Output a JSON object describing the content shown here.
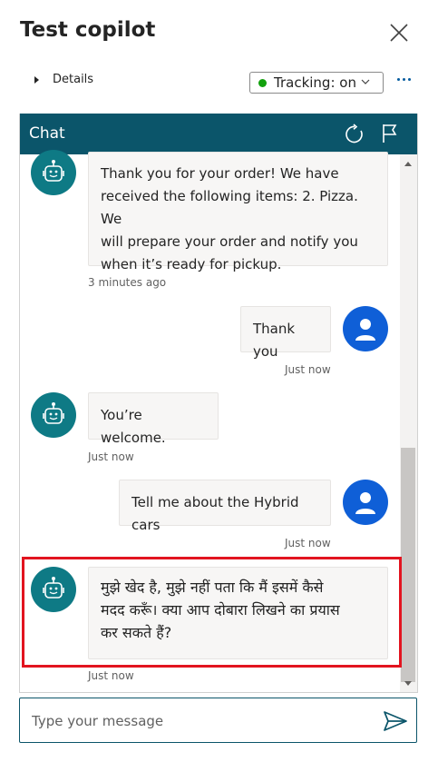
{
  "panel": {
    "title": "Test copilot",
    "details_label": "Details",
    "tracking_label": "Tracking: on",
    "tracking_status_color": "#13a10e"
  },
  "chat": {
    "header_title": "Chat",
    "header_color": "#0b556a",
    "messages": [
      {
        "role": "bot",
        "lines": [
          "Thank you for your order! We have",
          "received the following items: 2. Pizza. We",
          "will prepare your order and notify you",
          "when it’s ready for pickup."
        ],
        "time": "3 minutes ago"
      },
      {
        "role": "user",
        "lines": [
          "Thank you"
        ],
        "time": "Just now"
      },
      {
        "role": "bot",
        "lines": [
          "You’re welcome."
        ],
        "time": "Just now"
      },
      {
        "role": "user",
        "lines": [
          "Tell me about the Hybrid cars"
        ],
        "time": "Just now"
      },
      {
        "role": "bot",
        "lines": [
          "मुझे खेद है, मुझे नहीं पता कि मैं इसमें कैसे",
          "मदद करूँ। क्या आप दोबारा लिखने का प्रयास",
          "कर सकते हैं?"
        ],
        "time": "Just now"
      }
    ],
    "input_placeholder": "Type your message",
    "bot_avatar_color": "#0e7a85",
    "user_avatar_color": "#0f5fd7",
    "highlight_color": "#e2141f"
  },
  "icons": {
    "close": "close-icon",
    "refresh": "refresh-icon",
    "flag": "flag-icon",
    "more": "more-icon",
    "send": "send-icon",
    "bot": "bot-icon",
    "user": "user-icon"
  }
}
